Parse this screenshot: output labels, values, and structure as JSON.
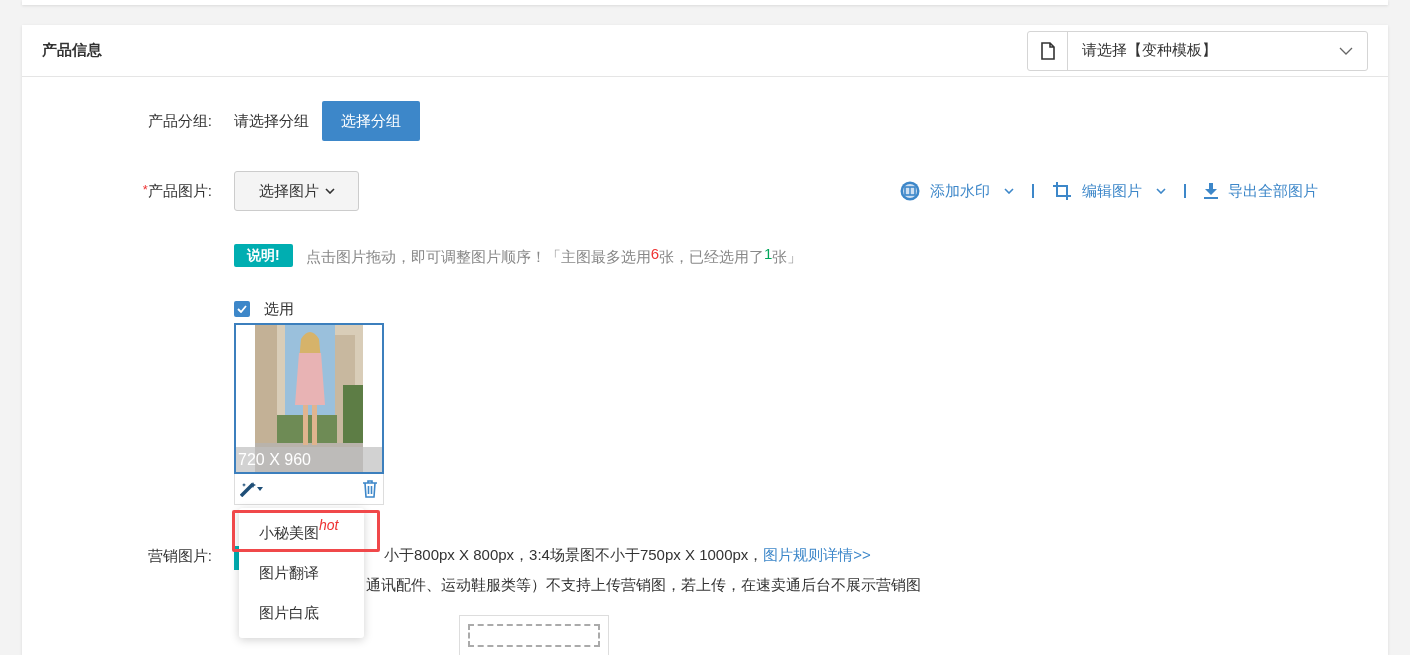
{
  "section": {
    "title": "产品信息",
    "template_select": {
      "placeholder": "请选择【变种模板】"
    }
  },
  "group_row": {
    "label": "产品分组:",
    "value": "请选择分组",
    "button": "选择分组"
  },
  "images_row": {
    "required_mark": "*",
    "label": "产品图片:",
    "button": "选择图片",
    "tools": [
      {
        "kind": "watermark",
        "label": "添加水印",
        "caret": true
      },
      {
        "kind": "crop",
        "label": "编辑图片",
        "caret": true
      },
      {
        "kind": "download",
        "label": "导出全部图片",
        "caret": false
      }
    ],
    "note": {
      "badge": "说明!",
      "text": "点击图片拖动，即可调整图片顺序！「主图最多选用",
      "max_count": "6",
      "middle": "张，已经选用了",
      "selected_count": "1",
      "end": "张」"
    },
    "images": [
      {
        "checkbox_label": "选用",
        "checked": true,
        "size": "720 X 960",
        "kind": "picture"
      }
    ]
  },
  "menu": {
    "items": [
      {
        "label": "小秘美图",
        "badge": "hot",
        "highlighted": true
      },
      {
        "label": "图片翻译",
        "highlighted": false
      },
      {
        "label": "图片白底",
        "highlighted": false
      }
    ]
  },
  "marketing_row": {
    "label": "营销图片:",
    "line_1": "小于800px X 800px，3:4场景图不小于750px X 1000px，",
    "link": "图片规则详情>>",
    "line_2": "通讯配件、运动鞋服类等）不支持上传营销图，若上传，在速卖通后台不展示营销图"
  }
}
